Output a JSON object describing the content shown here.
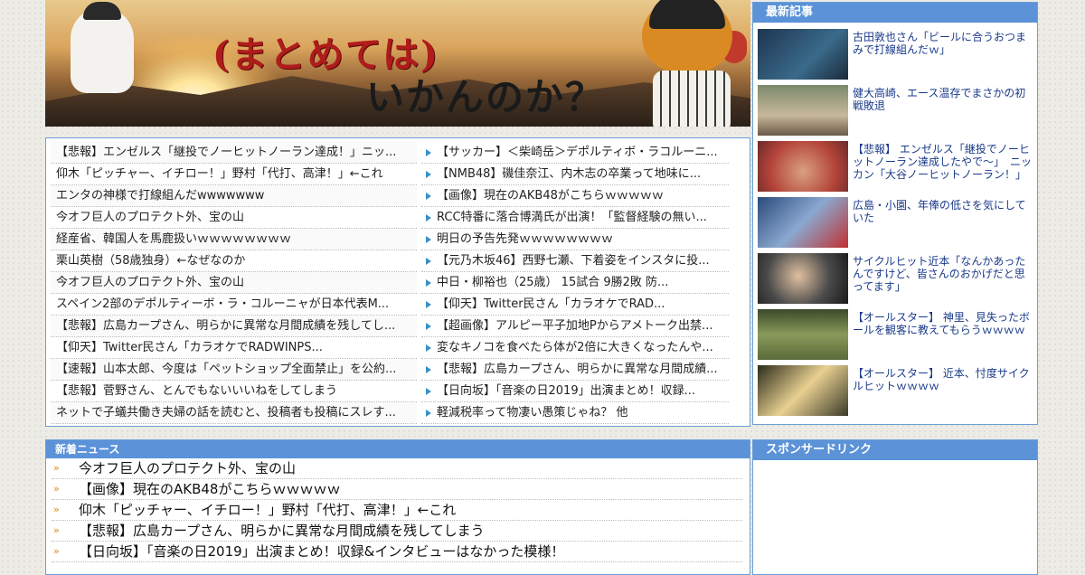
{
  "banner": {
    "title_line1": "(まとめては)",
    "title_line2": "いかんのか？"
  },
  "links_left": [
    "【悲報】エンゼルス「継投でノーヒットノーラン達成！」ニッ...",
    "仰木「ピッチャー、イチロー！」野村「代打、高津！」←これ",
    "エンタの神様で打線組んだwwwwwww",
    "今オフ巨人のプロテクト外、宝の山",
    "経産省、韓国人を馬鹿扱いｗｗｗｗｗｗｗｗ",
    "栗山英樹（58歳独身）←なぜなのか",
    "今オフ巨人のプロテクト外、宝の山",
    "スペイン2部のデポルティーボ・ラ・コルーニャが日本代表M...",
    "【悲報】広島カープさん、明らかに異常な月間成績を残してし...",
    "【仰天】Twitter民さん「カラオケでRADWINPS...",
    "【速報】山本太郎、今度は「ペットショップ全面禁止」を公約...",
    "【悲報】菅野さん、とんでもないいいねをしてしまう",
    "ネットで子蟻共働き夫婦の話を読むと、投稿者も投稿にスレす..."
  ],
  "links_right": [
    "【サッカー】＜柴崎岳＞デポルティボ・ラコルーニ...",
    "【NMB48】磯佳奈江、内木志の卒業って地味に...",
    "【画像】現在のAKB48がこちらｗｗｗｗｗ",
    "RCC特番に落合博満氏が出演！「監督経験の無い...",
    "明日の予告先発ｗｗｗｗｗｗｗｗ",
    "【元乃木坂46】西野七瀬、下着姿をインスタに投...",
    "中日・柳裕也（25歳） 15試合 9勝2敗 防...",
    "【仰天】Twitter民さん「カラオケでRAD...",
    "【超画像】アルピー平子加地Pからアメトーク出禁...",
    "変なキノコを食べたら体が2倍に大きくなったんや...",
    "【悲報】広島カープさん、明らかに異常な月間成績...",
    "【日向坂】「音楽の日2019」出演まとめ！収録...",
    "軽減税率って物凄い愚策じゃね？ 他"
  ],
  "latest": {
    "heading": "最新記事",
    "articles": [
      {
        "title": "古田敦也さん「ビールに合うおつまみで打線組んだｗ」",
        "color": "#2f4a6a"
      },
      {
        "title": "健大高崎、エース温存でまさかの初戦敗退",
        "color": "#6a7a5a"
      },
      {
        "title": "【悲報】 エンゼルス「継投でノーヒットノーラン達成したやで～」　ニッカン「大谷ノーヒットノーラン！」",
        "color": "#b4443a"
      },
      {
        "title": "広島・小園、年俸の低さを気にしていた",
        "color": "#3a5a8a"
      },
      {
        "title": "サイクルヒット近本「なんかあったんですけど、皆さんのおかげだと思ってます」",
        "color": "#3a3a3a"
      },
      {
        "title": "【オールスター】 神里、見失ったボールを観客に教えてもらうｗｗｗｗ",
        "color": "#5a6a3a"
      },
      {
        "title": "【オールスター】 近本、忖度サイクルヒットｗｗｗｗ",
        "color": "#4a4a3a"
      }
    ]
  },
  "news": {
    "heading": "新着ニュース",
    "items": [
      "今オフ巨人のプロテクト外、宝の山",
      "【画像】現在のAKB48がこちらｗｗｗｗｗ",
      "仰木「ピッチャー、イチロー！」野村「代打、高津！」←これ",
      "【悲報】広島カープさん、明らかに異常な月間成績を残してしまう",
      "【日向坂】「音楽の日2019」出演まとめ！収録&インタビューはなかった模様！"
    ]
  },
  "sponsor": {
    "heading": "スポンサードリンク"
  },
  "icons": {
    "list_bullet": "triangle-bullet-icon",
    "news_bullet": "double-chevron-icon"
  },
  "colors": {
    "panel_border": "#6a9fd6",
    "header_bg": "#5b92d8",
    "link_color": "#1a3a8a",
    "bullet_accent": "#e08a1a"
  }
}
